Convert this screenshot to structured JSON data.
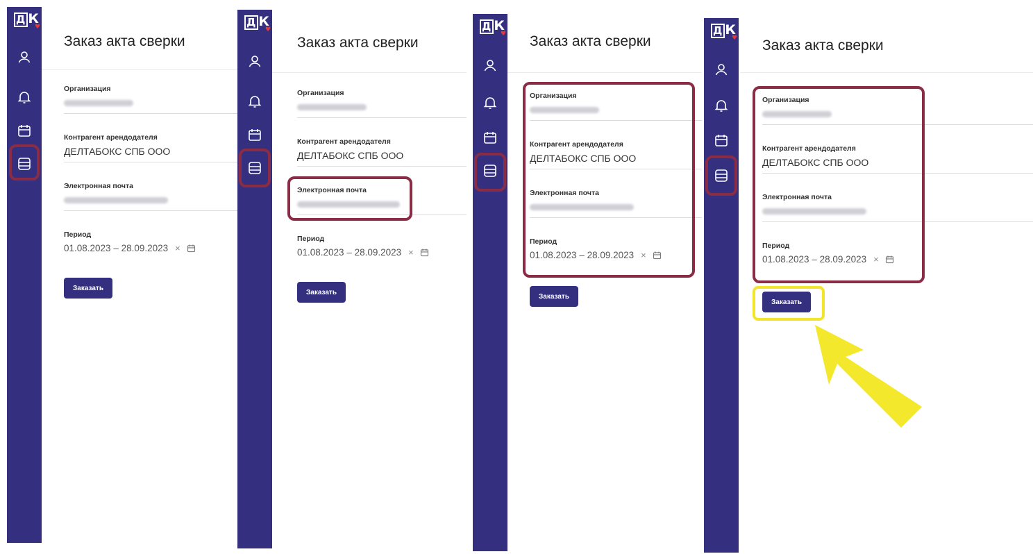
{
  "app": {
    "logo": "ДК",
    "logo_d": "Д",
    "logo_k": "К"
  },
  "page": {
    "title": "Заказ акта сверки",
    "organization_label": "Организация",
    "counterparty_label": "Контрагент арендодателя",
    "counterparty_value": "ДЕЛТАБОКС СПБ ООО",
    "email_label": "Электронная почта",
    "period_label": "Период",
    "period_value": "01.08.2023 – 28.09.2023",
    "clear_glyph": "×",
    "order_button": "Заказать"
  },
  "sidebar": {
    "icons": [
      "user-icon",
      "bell-icon",
      "calendar-icon",
      "document-icon"
    ],
    "active_icon": "document-icon"
  },
  "colors": {
    "sidebar": "#34307f",
    "highlight_red": "#8a2c45",
    "highlight_yellow": "#f3e52b",
    "button": "#34307f"
  }
}
